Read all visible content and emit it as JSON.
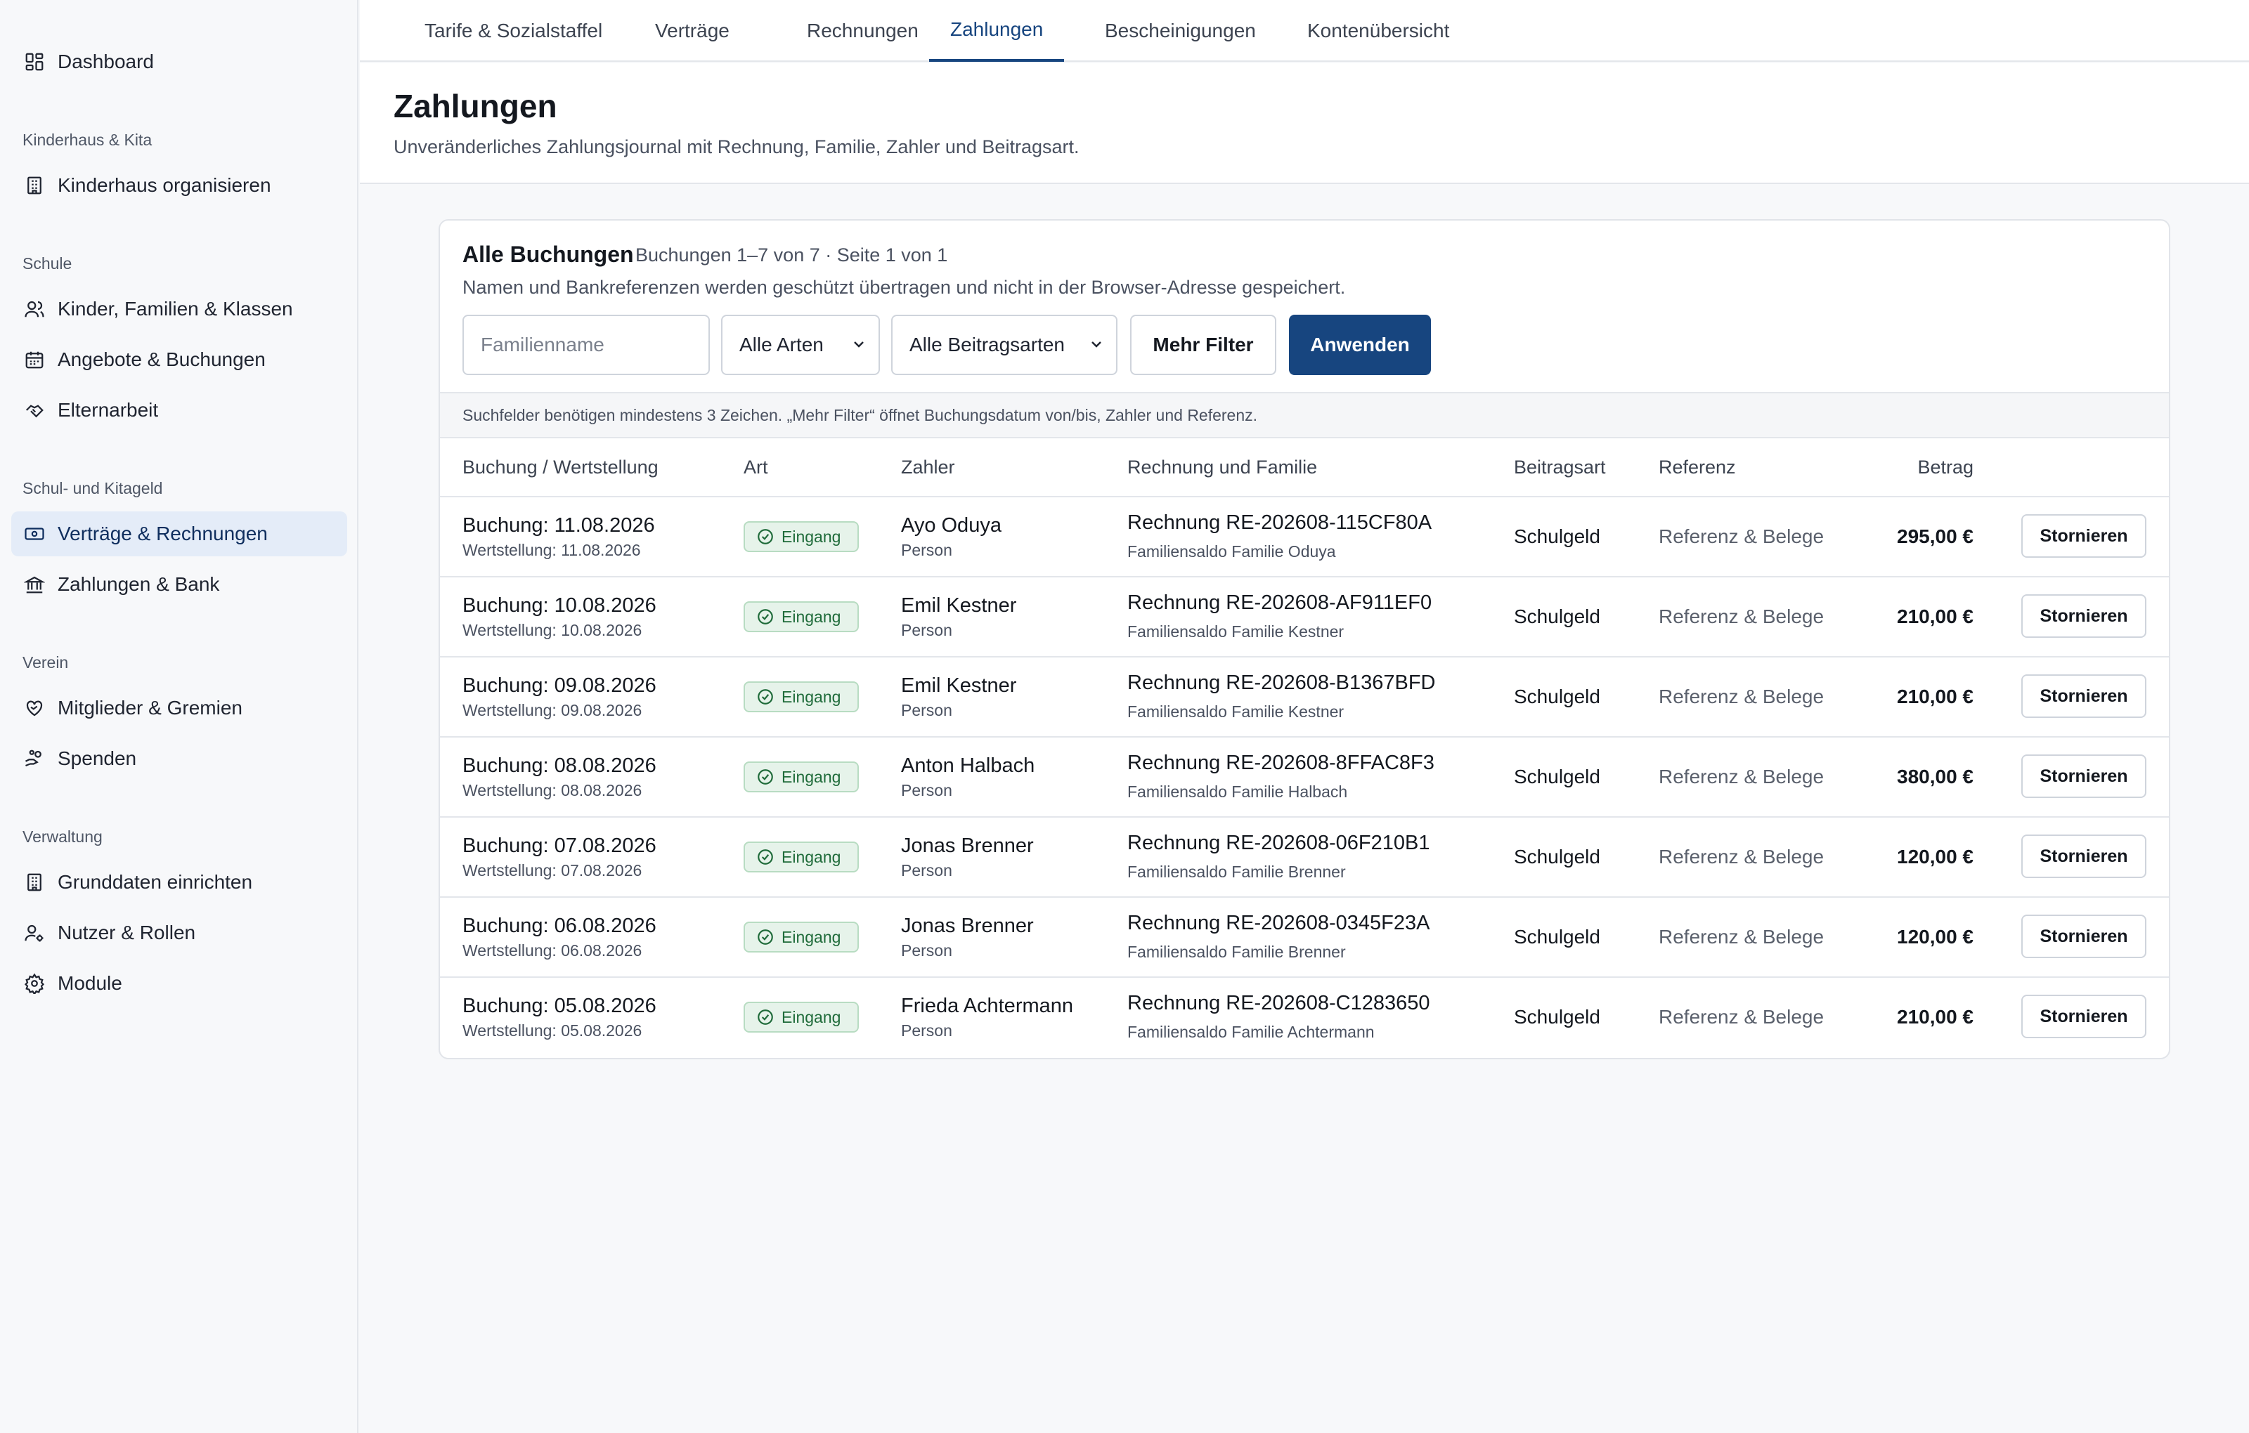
{
  "sidebar": {
    "top_item": {
      "label": "Dashboard",
      "icon": "dashboard-icon"
    },
    "groups": [
      {
        "label": "Kinderhaus & Kita"
      },
      {
        "label": "Schule"
      },
      {
        "label": "Schul- und Kitageld"
      },
      {
        "label": "Verein"
      },
      {
        "label": "Verwaltung"
      }
    ],
    "items": [
      {
        "label": "Kinderhaus organisieren",
        "icon": "building-icon"
      },
      {
        "label": "Kinder, Familien & Klassen",
        "icon": "users-icon"
      },
      {
        "label": "Angebote & Buchungen",
        "icon": "calendar-icon"
      },
      {
        "label": "Elternarbeit",
        "icon": "handshake-icon"
      },
      {
        "label": "Verträge & Rechnungen",
        "icon": "banknote-icon"
      },
      {
        "label": "Zahlungen & Bank",
        "icon": "bank-icon"
      },
      {
        "label": "Mitglieder & Gremien",
        "icon": "heart-handshake-icon"
      },
      {
        "label": "Spenden",
        "icon": "hand-coins-icon"
      },
      {
        "label": "Grunddaten einrichten",
        "icon": "building-icon"
      },
      {
        "label": "Nutzer & Rollen",
        "icon": "user-cog-icon"
      },
      {
        "label": "Module",
        "icon": "gear-icon"
      }
    ]
  },
  "tabs": [
    {
      "label": "Tarife & Sozialstaffel"
    },
    {
      "label": "Verträge"
    },
    {
      "label": "Rechnungen"
    },
    {
      "label": "Zahlungen"
    },
    {
      "label": "Bescheinigungen"
    },
    {
      "label": "Kontenübersicht"
    }
  ],
  "page": {
    "title": "Zahlungen",
    "subtitle": "Unveränderliches Zahlungsjournal mit Rechnung, Familie, Zahler und Beitragsart."
  },
  "card": {
    "title": "Alle Buchungen",
    "meta": "Buchungen 1–7 von 7 · Seite 1 von 1",
    "description": "Namen und Bankreferenzen werden geschützt übertragen und nicht in der Browser-Adresse gespeichert.",
    "filters": {
      "family_placeholder": "Familienname",
      "type_select": "Alle Arten",
      "fee_select": "Alle Beitragsarten",
      "more_label": "Mehr Filter",
      "apply_label": "Anwenden"
    },
    "hint": "Suchfelder benötigen mindestens 3 Zeichen. „Mehr Filter“ öffnet Buchungsdatum von/bis, Zahler und Referenz."
  },
  "table": {
    "headers": [
      "Buchung / Wertstellung",
      "Art",
      "Zahler",
      "Rechnung und Familie",
      "Beitragsart",
      "Referenz",
      "Betrag"
    ],
    "rows": [
      {
        "booking": "Buchung: 11.08.2026",
        "value_date": "Wertstellung: 11.08.2026",
        "type": "Eingang",
        "payer": "Ayo Oduya",
        "payer_kind": "Person",
        "invoice": "Rechnung RE-202608-115CF80A",
        "family": "Familiensaldo Familie Oduya",
        "fee_type": "Schulgeld",
        "reference": "Referenz & Belege",
        "amount": "295,00 €",
        "action": "Stornieren"
      },
      {
        "booking": "Buchung: 10.08.2026",
        "value_date": "Wertstellung: 10.08.2026",
        "type": "Eingang",
        "payer": "Emil Kestner",
        "payer_kind": "Person",
        "invoice": "Rechnung RE-202608-AF911EF0",
        "family": "Familiensaldo Familie Kestner",
        "fee_type": "Schulgeld",
        "reference": "Referenz & Belege",
        "amount": "210,00 €",
        "action": "Stornieren"
      },
      {
        "booking": "Buchung: 09.08.2026",
        "value_date": "Wertstellung: 09.08.2026",
        "type": "Eingang",
        "payer": "Emil Kestner",
        "payer_kind": "Person",
        "invoice": "Rechnung RE-202608-B1367BFD",
        "family": "Familiensaldo Familie Kestner",
        "fee_type": "Schulgeld",
        "reference": "Referenz & Belege",
        "amount": "210,00 €",
        "action": "Stornieren"
      },
      {
        "booking": "Buchung: 08.08.2026",
        "value_date": "Wertstellung: 08.08.2026",
        "type": "Eingang",
        "payer": "Anton Halbach",
        "payer_kind": "Person",
        "invoice": "Rechnung RE-202608-8FFAC8F3",
        "family": "Familiensaldo Familie Halbach",
        "fee_type": "Schulgeld",
        "reference": "Referenz & Belege",
        "amount": "380,00 €",
        "action": "Stornieren"
      },
      {
        "booking": "Buchung: 07.08.2026",
        "value_date": "Wertstellung: 07.08.2026",
        "type": "Eingang",
        "payer": "Jonas Brenner",
        "payer_kind": "Person",
        "invoice": "Rechnung RE-202608-06F210B1",
        "family": "Familiensaldo Familie Brenner",
        "fee_type": "Schulgeld",
        "reference": "Referenz & Belege",
        "amount": "120,00 €",
        "action": "Stornieren"
      },
      {
        "booking": "Buchung: 06.08.2026",
        "value_date": "Wertstellung: 06.08.2026",
        "type": "Eingang",
        "payer": "Jonas Brenner",
        "payer_kind": "Person",
        "invoice": "Rechnung RE-202608-0345F23A",
        "family": "Familiensaldo Familie Brenner",
        "fee_type": "Schulgeld",
        "reference": "Referenz & Belege",
        "amount": "120,00 €",
        "action": "Stornieren"
      },
      {
        "booking": "Buchung: 05.08.2026",
        "value_date": "Wertstellung: 05.08.2026",
        "type": "Eingang",
        "payer": "Frieda Achtermann",
        "payer_kind": "Person",
        "invoice": "Rechnung RE-202608-C1283650",
        "family": "Familiensaldo Familie Achtermann",
        "fee_type": "Schulgeld",
        "reference": "Referenz & Belege",
        "amount": "210,00 €",
        "action": "Stornieren"
      }
    ]
  },
  "colors": {
    "accent": "#17457f",
    "active_nav_bg": "#e4ecf8",
    "badge_bg": "#e6f3ea",
    "badge_text": "#1f6b3a"
  }
}
